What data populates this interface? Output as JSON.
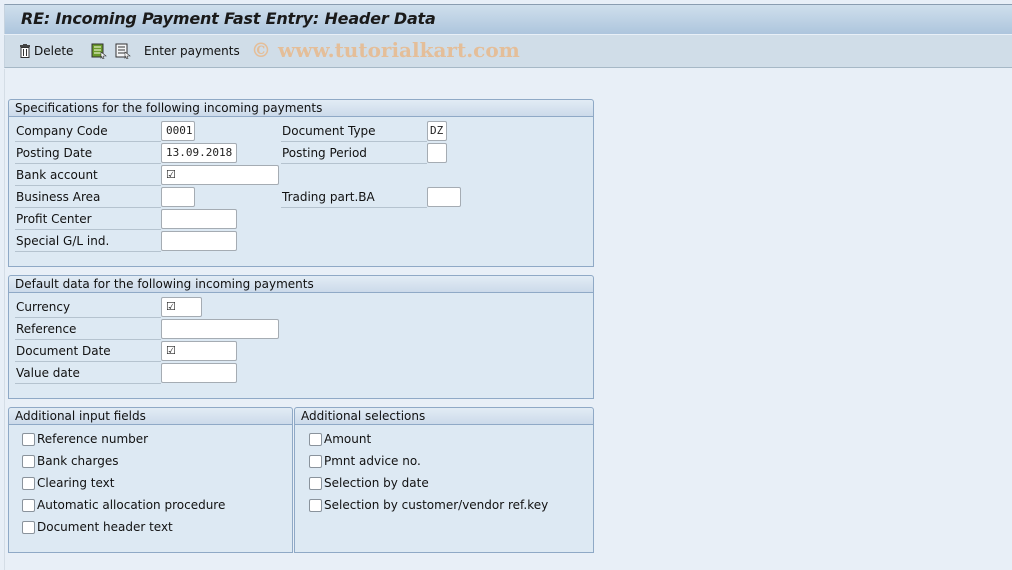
{
  "window": {
    "title": "RE: Incoming Payment Fast Entry: Header Data"
  },
  "toolbar": {
    "delete_label": "Delete",
    "enter_payments_label": "Enter payments",
    "watermark": "© www.tutorialkart.com"
  },
  "specifications": {
    "title": "Specifications for the following incoming payments",
    "company_code": {
      "label": "Company Code",
      "value": "0001"
    },
    "document_type": {
      "label": "Document Type",
      "value": "DZ"
    },
    "posting_date": {
      "label": "Posting Date",
      "value": "13.09.2018"
    },
    "posting_period": {
      "label": "Posting Period",
      "value": ""
    },
    "bank_account": {
      "label": "Bank account",
      "value": "☑"
    },
    "business_area": {
      "label": "Business Area",
      "value": ""
    },
    "trading_part_ba": {
      "label": "Trading part.BA",
      "value": ""
    },
    "profit_center": {
      "label": "Profit Center",
      "value": ""
    },
    "special_gl_ind": {
      "label": "Special G/L ind.",
      "value": ""
    }
  },
  "defaults": {
    "title": "Default data for the following incoming payments",
    "currency": {
      "label": "Currency",
      "value": "☑"
    },
    "reference": {
      "label": "Reference",
      "value": ""
    },
    "document_date": {
      "label": "Document Date",
      "value": "☑"
    },
    "value_date": {
      "label": "Value date",
      "value": ""
    }
  },
  "additional_input": {
    "title": "Additional input fields",
    "items": [
      {
        "label": "Reference number",
        "checked": false
      },
      {
        "label": "Bank charges",
        "checked": false
      },
      {
        "label": "Clearing text",
        "checked": false
      },
      {
        "label": "Automatic allocation procedure",
        "checked": false
      },
      {
        "label": "Document header text",
        "checked": false
      }
    ]
  },
  "additional_selections": {
    "title": "Additional selections",
    "items": [
      {
        "label": "Amount",
        "checked": false
      },
      {
        "label": "Pmnt advice no.",
        "checked": false
      },
      {
        "label": "Selection by date",
        "checked": false
      },
      {
        "label": "Selection by customer/vendor ref.key",
        "checked": false
      }
    ]
  }
}
